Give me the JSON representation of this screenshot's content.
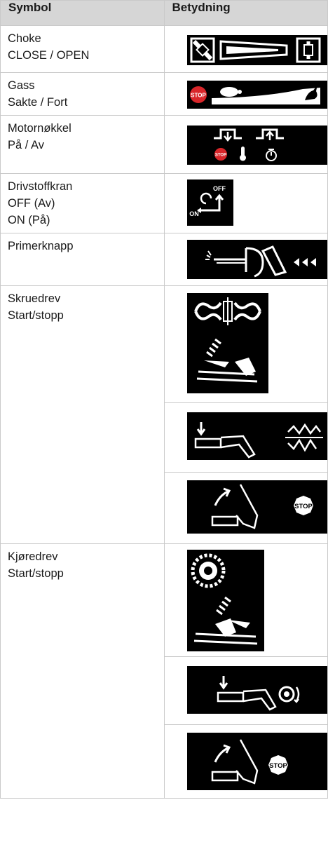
{
  "table": {
    "headers": [
      "Symbol",
      "Betydning"
    ],
    "rows": [
      {
        "lines": [
          "Choke",
          "CLOSE / OPEN"
        ]
      },
      {
        "lines": [
          "Gass",
          "Sakte / Fort"
        ]
      },
      {
        "lines": [
          "Motornøkkel",
          "På / Av"
        ]
      },
      {
        "lines": [
          "Drivstoffkran",
          "OFF (Av)",
          "ON (På)"
        ]
      },
      {
        "lines": [
          "Primerknapp"
        ]
      },
      {
        "lines": [
          "Skruedrev",
          "Start/stopp"
        ]
      },
      {
        "lines": [
          "Kjøredrev",
          "Start/stopp"
        ]
      }
    ]
  },
  "icons": {
    "stop_label": "STOP",
    "off_label": "OFF",
    "on_label": "ON"
  }
}
